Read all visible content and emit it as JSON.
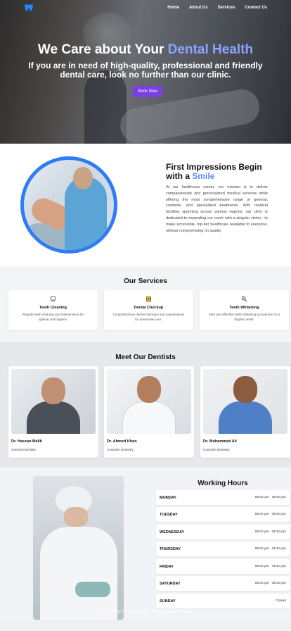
{
  "nav": {
    "items": [
      "Home",
      "About Us",
      "Services",
      "Contact Us"
    ]
  },
  "hero": {
    "title_prefix": "We Care about Your ",
    "title_accent": "Dental Health",
    "subtitle": "If you are in need of high-quality, professional and friendly dental care, look no further than our clinic.",
    "button": "Book Now"
  },
  "about": {
    "title_prefix": "First Impressions Begin with a ",
    "title_accent": "Smile",
    "text": "At our healthcare center, our mission is to deliver compassionate and personalized medical services while offering the most comprehensive range of general, cosmetic, and specialized treatments. With medical facilities spanning across various regions, our clinic is dedicated to expanding our reach with a singular vision - to make accessible, top-tier healthcare available to everyone, without compromising on quality."
  },
  "services": {
    "title": "Our Services",
    "items": [
      {
        "icon": "tooth-icon",
        "title": "Teeth Cleaning",
        "desc": "Regular teeth cleaning and maintenance for optimal oral hygiene."
      },
      {
        "icon": "dental-checkup-icon",
        "title": "Dental Checkup",
        "desc": "Comprehensive dental checkups and examinations for preventive care."
      },
      {
        "icon": "magnifier-icon",
        "title": "Teeth Whitening",
        "desc": "Safe and effective teeth whitening procedures for a brighter smile."
      }
    ]
  },
  "dentists": {
    "title": "Meet Our Dentists",
    "items": [
      {
        "name": "Dr. Hassan Malik",
        "specialty": "General Dentistry"
      },
      {
        "name": "Dr. Ahmed Khan",
        "specialty": "Cosmetic Dentistry"
      },
      {
        "name": "Dr. Muhammad Ali",
        "specialty": "Cosmetic Dentistry"
      }
    ]
  },
  "hours": {
    "title": "Working Hours",
    "rows": [
      {
        "day": "MONDAY",
        "time": "08:00 am - 05:00 pm"
      },
      {
        "day": "TUESDAY",
        "time": "08:00 pm - 05:00 pm"
      },
      {
        "day": "WEDNESDAY",
        "time": "08:00 pm - 05:00 pm"
      },
      {
        "day": "THURSDAY",
        "time": "08:00 pm - 05:00 pm"
      },
      {
        "day": "FRIDAY",
        "time": "08:00 pm - 05:00 pm"
      },
      {
        "day": "SATURDAY",
        "time": "08:00 pm - 05:00 pm"
      },
      {
        "day": "SUNDAY",
        "time": "Closed"
      }
    ]
  },
  "footer": {
    "note": "Visit www.healingwithin.com to learn more"
  },
  "colors": {
    "accent": "#7b3fe4",
    "title_accent": "#8ea2ff",
    "ring": "#2f7cf6"
  }
}
